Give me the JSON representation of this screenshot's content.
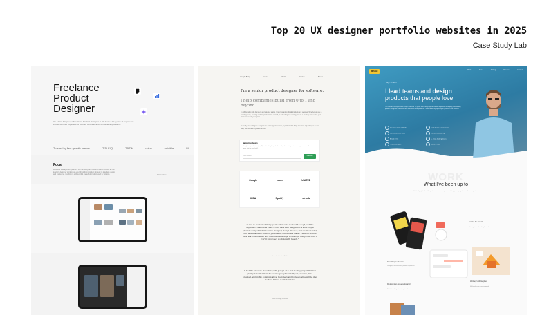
{
  "header": {
    "title": "Top 20 UX designer portfolio websites in 2025",
    "subtitle": "Case Study Lab"
  },
  "card1": {
    "title_lines": [
      "Freelance",
      "Product",
      "Designer"
    ],
    "description": "I'm Adrian Tiagosu, a Freelance Product Designer & UX Guide. 10+ years of experience in user-centred experiences for both business and consumer applications.",
    "logos_label": "Trusted by fast-growth brands",
    "logos": [
      "TITLEIQ",
      "TBTW",
      "volvo",
      "unicible",
      "W"
    ],
    "section_title": "Focal",
    "section_desc": "Workflow management platform for marketing and creative teams. Joined as the lead UX designer working on everything from product strategy to interface design and marketing, resulting in a thoughtful, beautiful product used by millions.",
    "view_link": "View case",
    "icons": [
      "figma-icon",
      "chart-icon",
      "sparkle-icon"
    ]
  },
  "card2": {
    "nav": [
      "Joseph Berry",
      "About",
      "Work",
      "Articles",
      "Books"
    ],
    "headline": "I'm a senior product designer for software.",
    "subhead": "I help companies build from 0 to 1 and beyond.",
    "para1": "In collaboration with founders and talented teams, I build engaging digital products and services. Whether you are a founding team, creating a whole product from scratch, or refreshing an existing product. I can help you realise your vision and reach your goals.",
    "para2": "Currently I'm leading the design team at Intelligent Verticals, a platform that helps investors. My writing is free to read, with some of my latest articles.",
    "newsletter": {
      "label": "Navigating design",
      "text": "Thoughts on product design, UX, and building things for the web, delivered to your inbox every few weeks. No spam, just the good stuff.",
      "placeholder": "Email address",
      "button": "Subscribe"
    },
    "logos": [
      "Google",
      "loom",
      "UNITED",
      "IKEA",
      "Spotify",
      "airbnb"
    ],
    "quote1": "\"I was so excited to finally get the chance to work with Joseph, and the experience was better than I could have ever imagined. He's not only a phenomenally skilled innovative designer, design director, and creative leader, but he is a fantastic mentor, personable, and selfless leader. He wore several hats as a both internal and client-side meetings, workshops, and production. A 10/10 for project working with Joseph.\"",
    "quote1_by": "Executive Director, Studio",
    "quote2": "\"I had the pleasure of working with Joseph on a fast-moving project that has greatly benefited from his talents. Joseph is intelligent, creative, time-oriented, and highly communicative. Designers and founders alike will be glad to have him as a collaborator.\"",
    "quote2_by": "Head of Design, Acme Inc"
  },
  "card3": {
    "logo": "DESIGN",
    "nav": [
      "Work",
      "About",
      "Writing",
      "Resume",
      "Contact"
    ],
    "tagline": "Hey, I'm Hiren",
    "headline_parts": [
      "I ",
      "lead",
      " teams and ",
      "design",
      " products that people love"
    ],
    "desc": "I'm a product designer and design lead with 10 years of industry experience and expertise in shaping and leading product design for consumer and enterprise-level products. I have found my specialty in products and services.",
    "stats": [
      "Designer at Cloud Studio",
      "Lead design at Cornerstone",
      "Worked across 4 cities",
      "Ex-Tata Consultancy",
      "Award at UX",
      "4+ years leading teams",
      "Product designer",
      "Based in India"
    ],
    "work_label": "WORK",
    "section_title": "What I've been up to",
    "section_desc": "Selected projects from the past few years across product strategy, design systems and user experience.",
    "projects": [
      {
        "title": "Everything In Reason",
        "desc": "Designing an end-to-end product experience."
      },
      {
        "title": "Scaling the Growth",
        "desc": "Reimagining onboarding for mobile."
      },
      {
        "title": "Redesigning conversational UX",
        "desc": "Product redesign for enterprise chat."
      },
      {
        "title": "Whitney's Marketplace",
        "desc": "Marketplace for creative goods."
      }
    ]
  }
}
